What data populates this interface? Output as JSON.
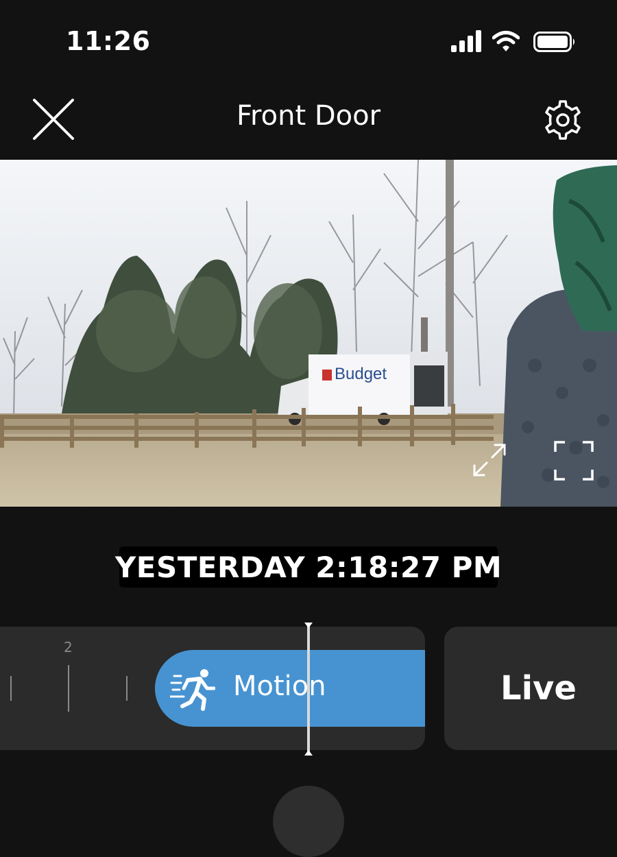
{
  "status_bar": {
    "time": "11:26",
    "icons": [
      "cellular-signal-icon",
      "wifi-icon",
      "battery-icon"
    ]
  },
  "header": {
    "title": "Front Door",
    "left_icon": "close-icon",
    "right_icon": "gear-icon"
  },
  "video": {
    "truck_text": "Budget",
    "controls": [
      "resize-icon",
      "fullscreen-icon"
    ]
  },
  "timestamp": "YESTERDAY 2:18:27 PM",
  "timeline": {
    "tick_label": "2",
    "event": {
      "label": "Motion",
      "icon": "running-person-icon",
      "color": "#4793d1"
    }
  },
  "live": {
    "label": "Live"
  },
  "colors": {
    "background": "#121212",
    "panel": "#2b2b2b",
    "accent": "#4793d1"
  }
}
